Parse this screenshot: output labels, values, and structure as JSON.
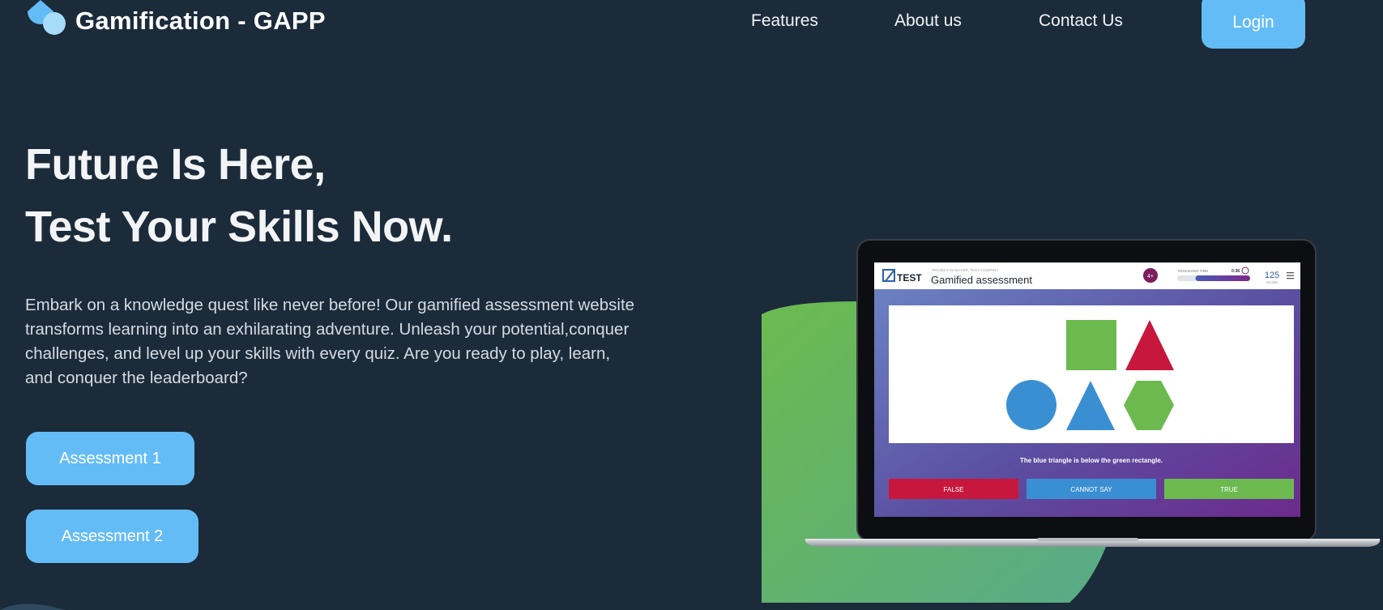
{
  "nav": {
    "brand": "Gamification - GAPP",
    "links": [
      "Features",
      "About us",
      "Contact Us"
    ],
    "login_label": "Login"
  },
  "hero": {
    "headline_line1": "Future Is Here,",
    "headline_line2": "Test Your Skills Now.",
    "description": "Embark on a knowledge quest like never before! Our gamified assessment website transforms learning into an exhilarating adventure. Unleash your potential,conquer challenges, and level up your skills with every quiz. Are you ready to play, learn, and conquer the leaderboard?",
    "buttons": [
      "Assessment 1",
      "Assessment 2"
    ]
  },
  "mockup": {
    "logo_text": "TEST",
    "subtitle": "PROJECT MANAGER, TEST COMPANY",
    "title": "Gamified assessment",
    "badge": "4+",
    "timer_label": "REMAINING TIME",
    "timer_value": "0:38",
    "timer_remaining": 0.75,
    "score": "125",
    "score_label": "SCORE",
    "question": "The blue triangle is below the green rectangle.",
    "answers": [
      "FALSE",
      "CANNOT SAY",
      "TRUE"
    ]
  },
  "colors": {
    "background": "#1b2b3a",
    "accent": "#64bcf6",
    "green": "#6cba4f",
    "red": "#c8173d",
    "blue": "#3a8fd2"
  }
}
